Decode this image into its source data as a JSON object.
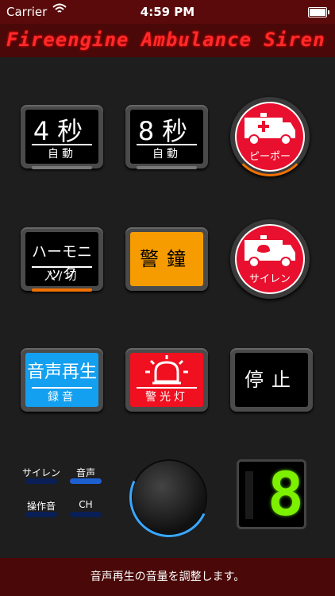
{
  "status_bar": {
    "carrier": "Carrier",
    "time": "4:59 PM"
  },
  "app": {
    "title": "Fireengine Ambulance Siren"
  },
  "buttons": {
    "four_sec": {
      "main": "4秒",
      "sub": "自動"
    },
    "eight_sec": {
      "main": "8秒",
      "sub": "自動"
    },
    "harmonic": {
      "main": "ハーモニック",
      "sub": "入/切"
    },
    "bell": {
      "main": "警鐘"
    },
    "voice_play": {
      "main": "音声再生",
      "sub": "録音"
    },
    "warning_light": {
      "sub": "警光灯"
    },
    "stop": {
      "main": "停止"
    },
    "pipo": {
      "label": "ピーポー"
    },
    "siren": {
      "label": "サイレン"
    }
  },
  "mode_labels": {
    "siren": "サイレン",
    "voice": "音声",
    "op_sound": "操作音",
    "ch": "CH"
  },
  "display": {
    "digit": "8"
  },
  "footer": {
    "message": "音声再生の音量を調整します。"
  },
  "colors": {
    "accent_red": "#e8102e",
    "led_orange": "#f07000",
    "knob_blue": "#39a8ff",
    "seg_green": "#7df000"
  }
}
